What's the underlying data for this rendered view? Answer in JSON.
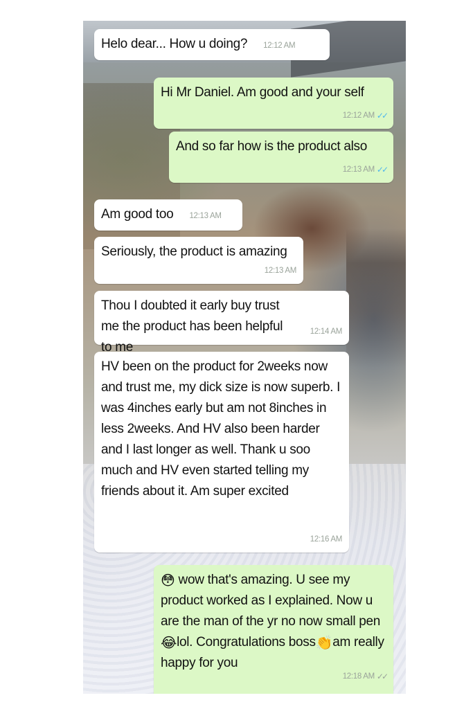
{
  "messages": [
    {
      "text": "Helo dear... How u doing?",
      "time": "12:12 AM",
      "direction": "incoming"
    },
    {
      "text": "Hi Mr Daniel. Am good and your self",
      "time": "12:12 AM",
      "direction": "outgoing",
      "ticks": "✓✓"
    },
    {
      "text": "And so far how is the product also",
      "time": "12:13 AM",
      "direction": "outgoing",
      "ticks": "✓✓"
    },
    {
      "text": "Am good too",
      "time": "12:13 AM",
      "direction": "incoming"
    },
    {
      "text": "Seriously, the product is amazing",
      "time": "12:13 AM",
      "direction": "incoming"
    },
    {
      "text": "Thou I doubted it early buy trust me the product has been helpful to me",
      "time": "12:14 AM",
      "direction": "incoming"
    },
    {
      "text": "HV been on the product for 2weeks now and trust me, my dick size is now superb. I  was 4inches early but am not 8inches in less 2weeks. And HV also been harder and I last longer as well. Thank u soo much and HV even started telling my friends about it. Am super excited",
      "time": "12:16 AM",
      "direction": "incoming"
    },
    {
      "part1": "wow that's amazing. U see my product worked as I explained. Now u are the man of the yr no now small pen",
      "part2": "lol. Congratulations boss",
      "part3": "am really happy for you",
      "emoji_flushed": "😳",
      "emoji_laugh": "😂",
      "emoji_clap": "👏",
      "time": "12:18 AM",
      "direction": "outgoing",
      "ticks": "✓✓"
    }
  ],
  "colors": {
    "incoming_bubble": "#ffffff",
    "outgoing_bubble": "#dcf8c6",
    "read_ticks": "#4fb6ec",
    "sent_ticks": "#9aa39a"
  }
}
